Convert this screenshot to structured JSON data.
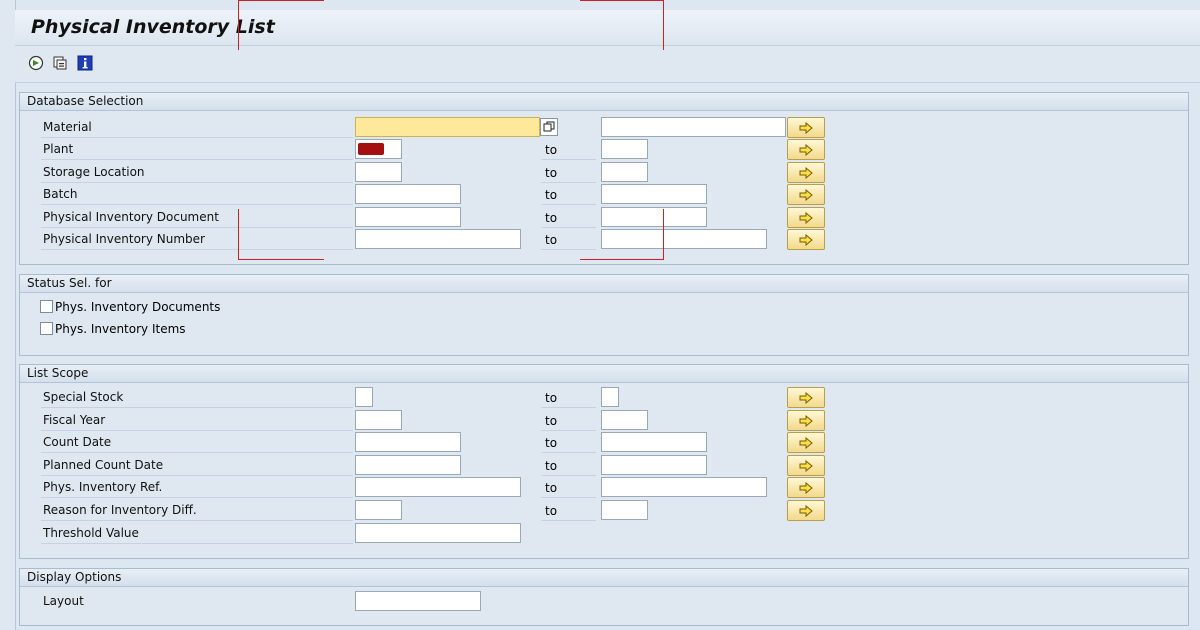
{
  "title": "Physical Inventory List",
  "toolbar": {
    "icons": [
      "execute-icon",
      "variant-icon",
      "info-icon"
    ]
  },
  "groups": {
    "database_selection": {
      "label": "Database Selection",
      "to_label": "to",
      "rows": [
        {
          "label": "Material",
          "low": "",
          "high": "",
          "has_to": false
        },
        {
          "label": "Plant",
          "low": "",
          "high": "",
          "has_to": true
        },
        {
          "label": "Storage Location",
          "low": "",
          "high": "",
          "has_to": true
        },
        {
          "label": "Batch",
          "low": "",
          "high": "",
          "has_to": true
        },
        {
          "label": "Physical Inventory Document",
          "low": "",
          "high": "",
          "has_to": true
        },
        {
          "label": "Physical Inventory Number",
          "low": "",
          "high": "",
          "has_to": true
        }
      ]
    },
    "status_sel": {
      "label": "Status Sel. for",
      "checkboxes": [
        {
          "label": "Phys. Inventory Documents",
          "checked": false
        },
        {
          "label": "Phys. Inventory Items",
          "checked": false
        }
      ]
    },
    "list_scope": {
      "label": "List Scope",
      "to_label": "to",
      "rows": [
        {
          "label": "Special Stock"
        },
        {
          "label": "Fiscal Year"
        },
        {
          "label": "Count Date"
        },
        {
          "label": "Planned Count Date"
        },
        {
          "label": "Phys. Inventory Ref."
        },
        {
          "label": "Reason for Inventory Diff."
        },
        {
          "label": "Threshold Value"
        }
      ]
    },
    "display_options": {
      "label": "Display Options",
      "rows": [
        {
          "label": "Layout",
          "value": ""
        }
      ]
    }
  },
  "colors": {
    "background": "#dfe8f1",
    "focus_field": "#fde999",
    "button": "#f3d98a",
    "annotation": "#d02020"
  }
}
